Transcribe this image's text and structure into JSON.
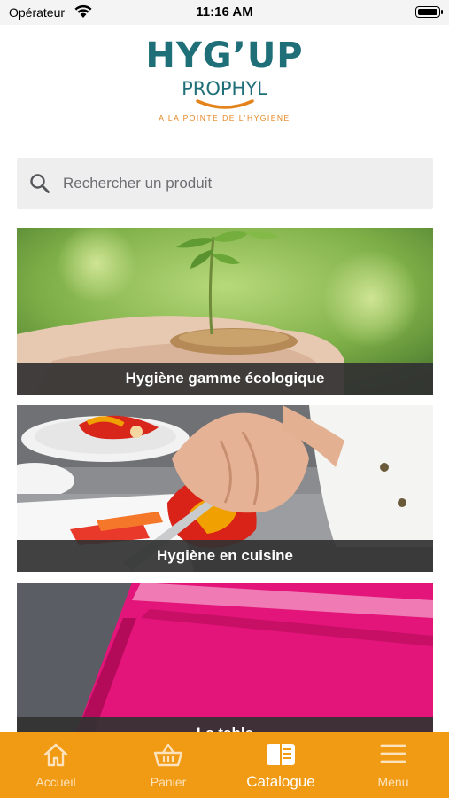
{
  "status_bar": {
    "carrier": "Opérateur",
    "time": "11:16 AM"
  },
  "logo": {
    "brand": "HYG’UP",
    "sub": "PROPHYL",
    "tagline": "A LA POINTE DE L’HYGIENE"
  },
  "search": {
    "placeholder": "Rechercher un produit"
  },
  "categories": [
    {
      "label": "Hygiène gamme écologique"
    },
    {
      "label": "Hygiène en cuisine"
    },
    {
      "label": "La table"
    }
  ],
  "tabbar": {
    "tabs": [
      {
        "label": "Accueil",
        "icon": "home-icon"
      },
      {
        "label": "Panier",
        "icon": "basket-icon"
      },
      {
        "label": "Catalogue",
        "icon": "catalogue-icon",
        "active": true
      },
      {
        "label": "Menu",
        "icon": "hamburger-menu-icon"
      }
    ]
  },
  "colors": {
    "brand_teal": "#1f6f78",
    "brand_orange": "#e4831c",
    "tabbar_orange": "#f19a13"
  }
}
